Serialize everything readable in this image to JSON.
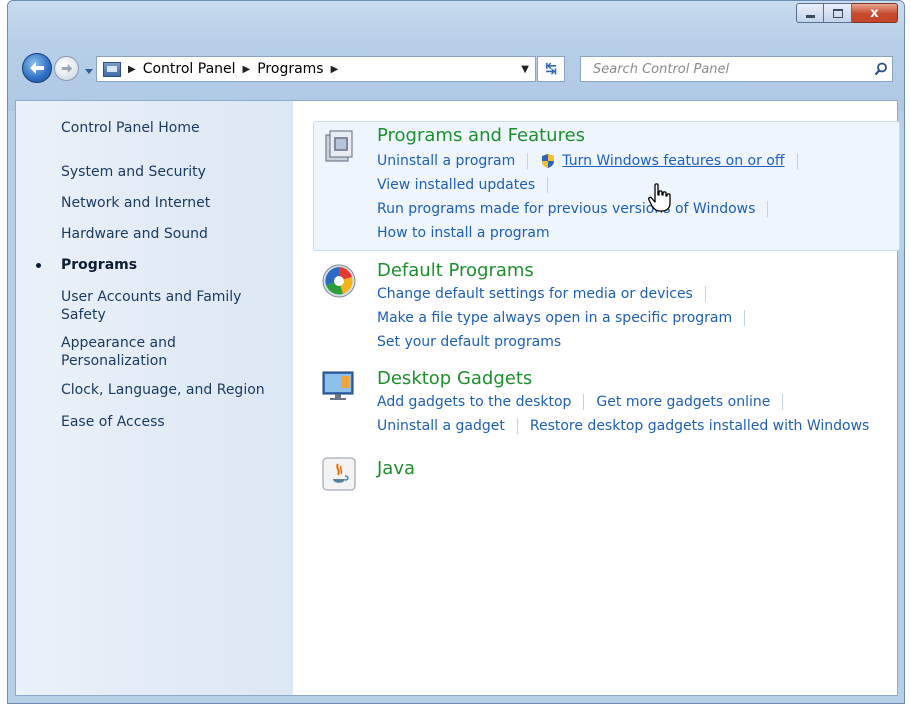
{
  "window": {
    "controls": {
      "minimize_icon": "minimize-icon",
      "maximize_icon": "maximize-icon",
      "close_label": "x"
    }
  },
  "address_bar": {
    "breadcrumb": [
      "Control Panel",
      "Programs"
    ],
    "search_placeholder": "Search Control Panel"
  },
  "sidebar": {
    "items": [
      {
        "label": "Control Panel Home",
        "active": false
      },
      {
        "label": "System and Security",
        "active": false
      },
      {
        "label": "Network and Internet",
        "active": false
      },
      {
        "label": "Hardware and Sound",
        "active": false
      },
      {
        "label": "Programs",
        "active": true
      },
      {
        "label": "User Accounts and Family Safety",
        "active": false
      },
      {
        "label": "Appearance and Personalization",
        "active": false
      },
      {
        "label": "Clock, Language, and Region",
        "active": false
      },
      {
        "label": "Ease of Access",
        "active": false
      }
    ]
  },
  "categories": [
    {
      "title": "Programs and Features",
      "icon": "programs-features-icon",
      "rows": [
        [
          "Uninstall a program",
          "Turn Windows features on or off"
        ],
        [
          "View installed updates"
        ],
        [
          "Run programs made for previous versions of Windows"
        ],
        [
          "How to install a program"
        ]
      ]
    },
    {
      "title": "Default Programs",
      "icon": "default-programs-icon",
      "rows": [
        [
          "Change default settings for media or devices"
        ],
        [
          "Make a file type always open in a specific program"
        ],
        [
          "Set your default programs"
        ]
      ]
    },
    {
      "title": "Desktop Gadgets",
      "icon": "desktop-gadgets-icon",
      "rows": [
        [
          "Add gadgets to the desktop",
          "Get more gadgets online"
        ],
        [
          "Uninstall a gadget",
          "Restore desktop gadgets installed with Windows"
        ]
      ]
    },
    {
      "title": "Java",
      "icon": "java-icon",
      "rows": []
    }
  ],
  "colors": {
    "link": "#1e5fb3",
    "category_title": "#1e8f2f",
    "sidebar_bg": "#dbe7f4",
    "highlight_bg": "#eef5fd"
  }
}
